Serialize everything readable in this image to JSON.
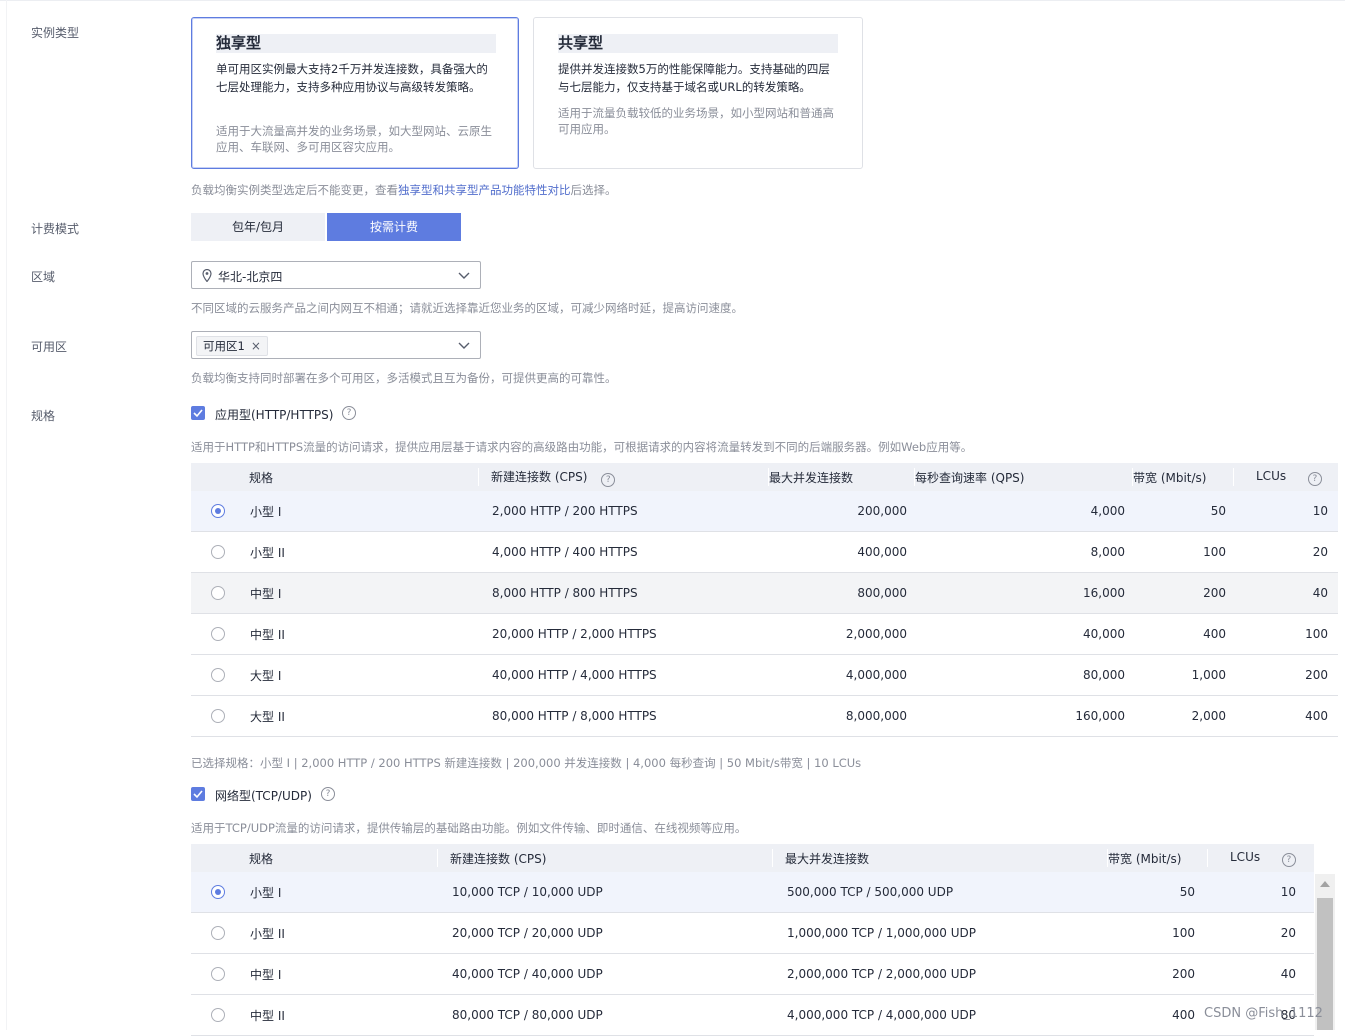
{
  "labels": {
    "instance_type": "实例类型",
    "billing": "计费模式",
    "region": "区域",
    "az": "可用区",
    "spec": "规格"
  },
  "instance_cards": {
    "dedicated": {
      "title": "独享型",
      "desc": "单可用区实例最大支持2千万并发连接数，具备强大的七层处理能力，支持多种应用协议与高级转发策略。",
      "usage": "适用于大流量高并发的业务场景，如大型网站、云原生应用、车联网、多可用区容灾应用。"
    },
    "shared": {
      "title": "共享型",
      "desc": "提供并发连接数5万的性能保障能力。支持基础的四层与七层能力，仅支持基于域名或URL的转发策略。",
      "usage": "适用于流量负载较低的业务场景，如小型网站和普通高可用应用。"
    }
  },
  "instance_hint": {
    "before": "负载均衡实例类型选定后不能变更，查看",
    "link": "独享型和共享型产品功能特性对比",
    "after": "后选择。"
  },
  "billing": {
    "option_yearly": "包年/包月",
    "option_ondemand": "按需计费"
  },
  "region": {
    "value": "华北-北京四",
    "hint": "不同区域的云服务产品之间内网互不相通；请就近选择靠近您业务的区域，可减少网络时延，提高访问速度。"
  },
  "az": {
    "tag": "可用区1",
    "hint": "负载均衡支持同时部署在多个可用区，多活模式且互为备份，可提供更高的可靠性。"
  },
  "app_spec": {
    "checkbox_label": "应用型(HTTP/HTTPS)",
    "desc": "适用于HTTP和HTTPS流量的访问请求，提供应用层基于请求内容的高级路由功能，可根据请求的内容将流量转发到不同的后端服务器。例如Web应用等。",
    "headers": [
      "规格",
      "新建连接数 (CPS)",
      "最大并发连接数",
      "每秒查询速率 (QPS)",
      "带宽 (Mbit/s)",
      "LCUs"
    ],
    "rows": [
      [
        "小型 I",
        "2,000 HTTP / 200 HTTPS",
        "200,000",
        "4,000",
        "50",
        "10"
      ],
      [
        "小型 II",
        "4,000 HTTP / 400 HTTPS",
        "400,000",
        "8,000",
        "100",
        "20"
      ],
      [
        "中型 I",
        "8,000 HTTP / 800 HTTPS",
        "800,000",
        "16,000",
        "200",
        "40"
      ],
      [
        "中型 II",
        "20,000 HTTP / 2,000 HTTPS",
        "2,000,000",
        "40,000",
        "400",
        "100"
      ],
      [
        "大型 I",
        "40,000 HTTP / 4,000 HTTPS",
        "4,000,000",
        "80,000",
        "1,000",
        "200"
      ],
      [
        "大型 II",
        "80,000 HTTP / 8,000 HTTPS",
        "8,000,000",
        "160,000",
        "2,000",
        "400"
      ]
    ],
    "selected_summary": "已选择规格：小型 I | 2,000 HTTP / 200 HTTPS 新建连接数 | 200,000 并发连接数 | 4,000 每秒查询 | 50 Mbit/s带宽 | 10 LCUs"
  },
  "net_spec": {
    "checkbox_label": "网络型(TCP/UDP)",
    "desc": "适用于TCP/UDP流量的访问请求，提供传输层的基础路由功能。例如文件传输、即时通信、在线视频等应用。",
    "headers": [
      "规格",
      "新建连接数 (CPS)",
      "最大并发连接数",
      "带宽 (Mbit/s)",
      "LCUs"
    ],
    "rows": [
      [
        "小型 I",
        "10,000 TCP / 10,000 UDP",
        "500,000 TCP / 500,000 UDP",
        "50",
        "10"
      ],
      [
        "小型 II",
        "20,000 TCP / 20,000 UDP",
        "1,000,000 TCP / 1,000,000 UDP",
        "100",
        "20"
      ],
      [
        "中型 I",
        "40,000 TCP / 40,000 UDP",
        "2,000,000 TCP / 2,000,000 UDP",
        "200",
        "40"
      ],
      [
        "中型 II",
        "80,000 TCP / 80,000 UDP",
        "4,000,000 TCP / 4,000,000 UDP",
        "400",
        "80"
      ]
    ]
  },
  "watermark": "CSDN @Fish_1112",
  "colors": {
    "accent": "#5e7ce0",
    "header_bg": "#eef0f5",
    "hint": "#8a8e99"
  }
}
